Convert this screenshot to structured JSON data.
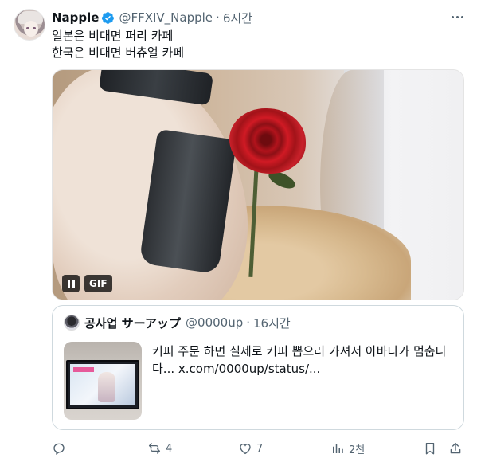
{
  "tweet": {
    "author_name": "Napple",
    "handle": "@FFXIV_Napple",
    "separator": "·",
    "time": "6시간",
    "lines": [
      "일본은 비대면 퍼리 카페",
      "한국은 비대면 버츄얼 카페"
    ],
    "media": {
      "badge": "GIF"
    }
  },
  "quoted": {
    "author_name": "공사업 サーアップ",
    "handle": "@0000up",
    "separator": "·",
    "time": "16시간",
    "text_line1": "커피 주문 하면 실제로 커피 뽑으러 가셔서 아바타가 멈춥니",
    "text_line2": "다...  x.com/0000up/status/..."
  },
  "actions": {
    "replies": "",
    "reposts": "4",
    "likes": "7",
    "views": "2천"
  },
  "colors": {
    "verified": "#1d9bf0",
    "muted": "#536471",
    "border": "#cfd9de"
  }
}
